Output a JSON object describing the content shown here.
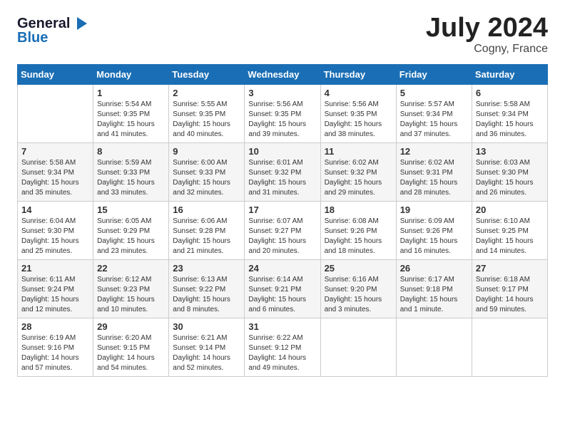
{
  "logo": {
    "line1": "General",
    "line2": "Blue",
    "icon": "▶"
  },
  "title": "July 2024",
  "location": "Cogny, France",
  "days_of_week": [
    "Sunday",
    "Monday",
    "Tuesday",
    "Wednesday",
    "Thursday",
    "Friday",
    "Saturday"
  ],
  "weeks": [
    [
      {
        "day": "",
        "text": ""
      },
      {
        "day": "1",
        "text": "Sunrise: 5:54 AM\nSunset: 9:35 PM\nDaylight: 15 hours\nand 41 minutes."
      },
      {
        "day": "2",
        "text": "Sunrise: 5:55 AM\nSunset: 9:35 PM\nDaylight: 15 hours\nand 40 minutes."
      },
      {
        "day": "3",
        "text": "Sunrise: 5:56 AM\nSunset: 9:35 PM\nDaylight: 15 hours\nand 39 minutes."
      },
      {
        "day": "4",
        "text": "Sunrise: 5:56 AM\nSunset: 9:35 PM\nDaylight: 15 hours\nand 38 minutes."
      },
      {
        "day": "5",
        "text": "Sunrise: 5:57 AM\nSunset: 9:34 PM\nDaylight: 15 hours\nand 37 minutes."
      },
      {
        "day": "6",
        "text": "Sunrise: 5:58 AM\nSunset: 9:34 PM\nDaylight: 15 hours\nand 36 minutes."
      }
    ],
    [
      {
        "day": "7",
        "text": "Sunrise: 5:58 AM\nSunset: 9:34 PM\nDaylight: 15 hours\nand 35 minutes."
      },
      {
        "day": "8",
        "text": "Sunrise: 5:59 AM\nSunset: 9:33 PM\nDaylight: 15 hours\nand 33 minutes."
      },
      {
        "day": "9",
        "text": "Sunrise: 6:00 AM\nSunset: 9:33 PM\nDaylight: 15 hours\nand 32 minutes."
      },
      {
        "day": "10",
        "text": "Sunrise: 6:01 AM\nSunset: 9:32 PM\nDaylight: 15 hours\nand 31 minutes."
      },
      {
        "day": "11",
        "text": "Sunrise: 6:02 AM\nSunset: 9:32 PM\nDaylight: 15 hours\nand 29 minutes."
      },
      {
        "day": "12",
        "text": "Sunrise: 6:02 AM\nSunset: 9:31 PM\nDaylight: 15 hours\nand 28 minutes."
      },
      {
        "day": "13",
        "text": "Sunrise: 6:03 AM\nSunset: 9:30 PM\nDaylight: 15 hours\nand 26 minutes."
      }
    ],
    [
      {
        "day": "14",
        "text": "Sunrise: 6:04 AM\nSunset: 9:30 PM\nDaylight: 15 hours\nand 25 minutes."
      },
      {
        "day": "15",
        "text": "Sunrise: 6:05 AM\nSunset: 9:29 PM\nDaylight: 15 hours\nand 23 minutes."
      },
      {
        "day": "16",
        "text": "Sunrise: 6:06 AM\nSunset: 9:28 PM\nDaylight: 15 hours\nand 21 minutes."
      },
      {
        "day": "17",
        "text": "Sunrise: 6:07 AM\nSunset: 9:27 PM\nDaylight: 15 hours\nand 20 minutes."
      },
      {
        "day": "18",
        "text": "Sunrise: 6:08 AM\nSunset: 9:26 PM\nDaylight: 15 hours\nand 18 minutes."
      },
      {
        "day": "19",
        "text": "Sunrise: 6:09 AM\nSunset: 9:26 PM\nDaylight: 15 hours\nand 16 minutes."
      },
      {
        "day": "20",
        "text": "Sunrise: 6:10 AM\nSunset: 9:25 PM\nDaylight: 15 hours\nand 14 minutes."
      }
    ],
    [
      {
        "day": "21",
        "text": "Sunrise: 6:11 AM\nSunset: 9:24 PM\nDaylight: 15 hours\nand 12 minutes."
      },
      {
        "day": "22",
        "text": "Sunrise: 6:12 AM\nSunset: 9:23 PM\nDaylight: 15 hours\nand 10 minutes."
      },
      {
        "day": "23",
        "text": "Sunrise: 6:13 AM\nSunset: 9:22 PM\nDaylight: 15 hours\nand 8 minutes."
      },
      {
        "day": "24",
        "text": "Sunrise: 6:14 AM\nSunset: 9:21 PM\nDaylight: 15 hours\nand 6 minutes."
      },
      {
        "day": "25",
        "text": "Sunrise: 6:16 AM\nSunset: 9:20 PM\nDaylight: 15 hours\nand 3 minutes."
      },
      {
        "day": "26",
        "text": "Sunrise: 6:17 AM\nSunset: 9:18 PM\nDaylight: 15 hours\nand 1 minute."
      },
      {
        "day": "27",
        "text": "Sunrise: 6:18 AM\nSunset: 9:17 PM\nDaylight: 14 hours\nand 59 minutes."
      }
    ],
    [
      {
        "day": "28",
        "text": "Sunrise: 6:19 AM\nSunset: 9:16 PM\nDaylight: 14 hours\nand 57 minutes."
      },
      {
        "day": "29",
        "text": "Sunrise: 6:20 AM\nSunset: 9:15 PM\nDaylight: 14 hours\nand 54 minutes."
      },
      {
        "day": "30",
        "text": "Sunrise: 6:21 AM\nSunset: 9:14 PM\nDaylight: 14 hours\nand 52 minutes."
      },
      {
        "day": "31",
        "text": "Sunrise: 6:22 AM\nSunset: 9:12 PM\nDaylight: 14 hours\nand 49 minutes."
      },
      {
        "day": "",
        "text": ""
      },
      {
        "day": "",
        "text": ""
      },
      {
        "day": "",
        "text": ""
      }
    ]
  ]
}
